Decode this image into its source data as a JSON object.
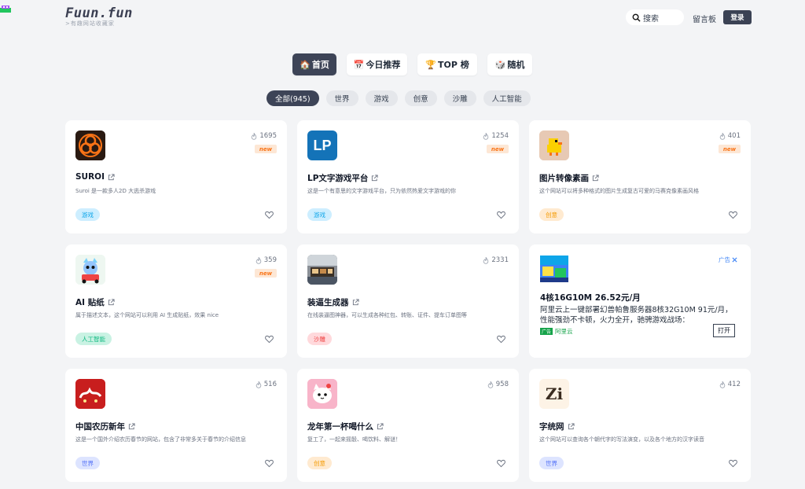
{
  "brand": {
    "logo": "Fuun.fun",
    "tagline": ">有趣网站收藏家"
  },
  "header": {
    "search_label": "搜索",
    "guestbook": "留言板",
    "login": "登录"
  },
  "tabs": [
    {
      "emoji": "🏠",
      "label": "首页",
      "active": true
    },
    {
      "emoji": "📅",
      "label": "今日推荐",
      "active": false
    },
    {
      "emoji": "🏆",
      "label": "TOP 榜",
      "active": false
    },
    {
      "emoji": "🎲",
      "label": "随机",
      "active": false
    }
  ],
  "categories": [
    {
      "label": "全部(945)",
      "active": true
    },
    {
      "label": "世界",
      "active": false
    },
    {
      "label": "游戏",
      "active": false
    },
    {
      "label": "创意",
      "active": false
    },
    {
      "label": "沙雕",
      "active": false
    },
    {
      "label": "人工智能",
      "active": false
    }
  ],
  "cards": [
    {
      "title": "SUROI",
      "desc": "Suroi 是一款多人2D 大逃杀游戏",
      "views": "1695",
      "new": "new",
      "tag": "游戏",
      "tag_class": "game",
      "icon": "biohazard-icon"
    },
    {
      "title": "LP文字游戏平台",
      "desc": "这是一个有意思的文字游戏平台，只为依然热爱文字游戏的你",
      "views": "1254",
      "new": "new",
      "tag": "游戏",
      "tag_class": "game",
      "icon": "lp-logo-icon",
      "icon_text": "LP"
    },
    {
      "title": "图片转像素画",
      "desc": "这个网站可以将多种格式的图片生成复古可爱的马赛克像素画风格",
      "views": "401",
      "new": "new",
      "tag": "创意",
      "tag_class": "creative",
      "icon": "pixel-duck-icon"
    },
    {
      "title": "AI 贴纸",
      "desc": "属于描述文本，这个网站可以利用 AI 生成贴纸，效果 nice",
      "views": "359",
      "new": "new",
      "tag": "人工智能",
      "tag_class": "ai",
      "icon": "robot-cat-icon"
    },
    {
      "title": "装逼生成器",
      "desc": "在线装逼图神器，可以生成各种红包、转账、证件、提车订单图等",
      "views": "2331",
      "new": "",
      "tag": "沙雕",
      "tag_class": "sculpt",
      "icon": "photo-icon"
    },
    {
      "title": "中国农历新年",
      "desc": "这是一个国外介绍农历春节的网站，包含了非常多关于春节的介绍信息",
      "views": "516",
      "new": "",
      "tag": "世界",
      "tag_class": "world",
      "icon": "lunar-new-year-icon"
    },
    {
      "title": "龙年第一杯喝什么",
      "desc": "复工了，一起来摇骰、喝饮料、解谜！",
      "views": "958",
      "new": "",
      "tag": "创意",
      "tag_class": "creative",
      "icon": "cute-cat-icon"
    },
    {
      "title": "字统网",
      "desc": "这个网站可以查询各个朝代字的写法演变，以及各个地方的汉字读音",
      "views": "412",
      "new": "",
      "tag": "世界",
      "tag_class": "world",
      "icon": "zi-glyph-icon",
      "icon_text": "Zi"
    }
  ],
  "ad": {
    "mark": "广告",
    "title": "4核16G10M 26.52元/月",
    "desc": "阿里云上一键部署幻兽帕鲁服务器8核32G10M 91元/月，性能强劲不卡顿，火力全开，驰骋游戏战场：",
    "brand_tag": "广告",
    "brand": "阿里云",
    "open": "打开"
  },
  "colors": {
    "accent": "#3d4457",
    "background": "#f3f4f6",
    "new_badge": "#f97316"
  }
}
